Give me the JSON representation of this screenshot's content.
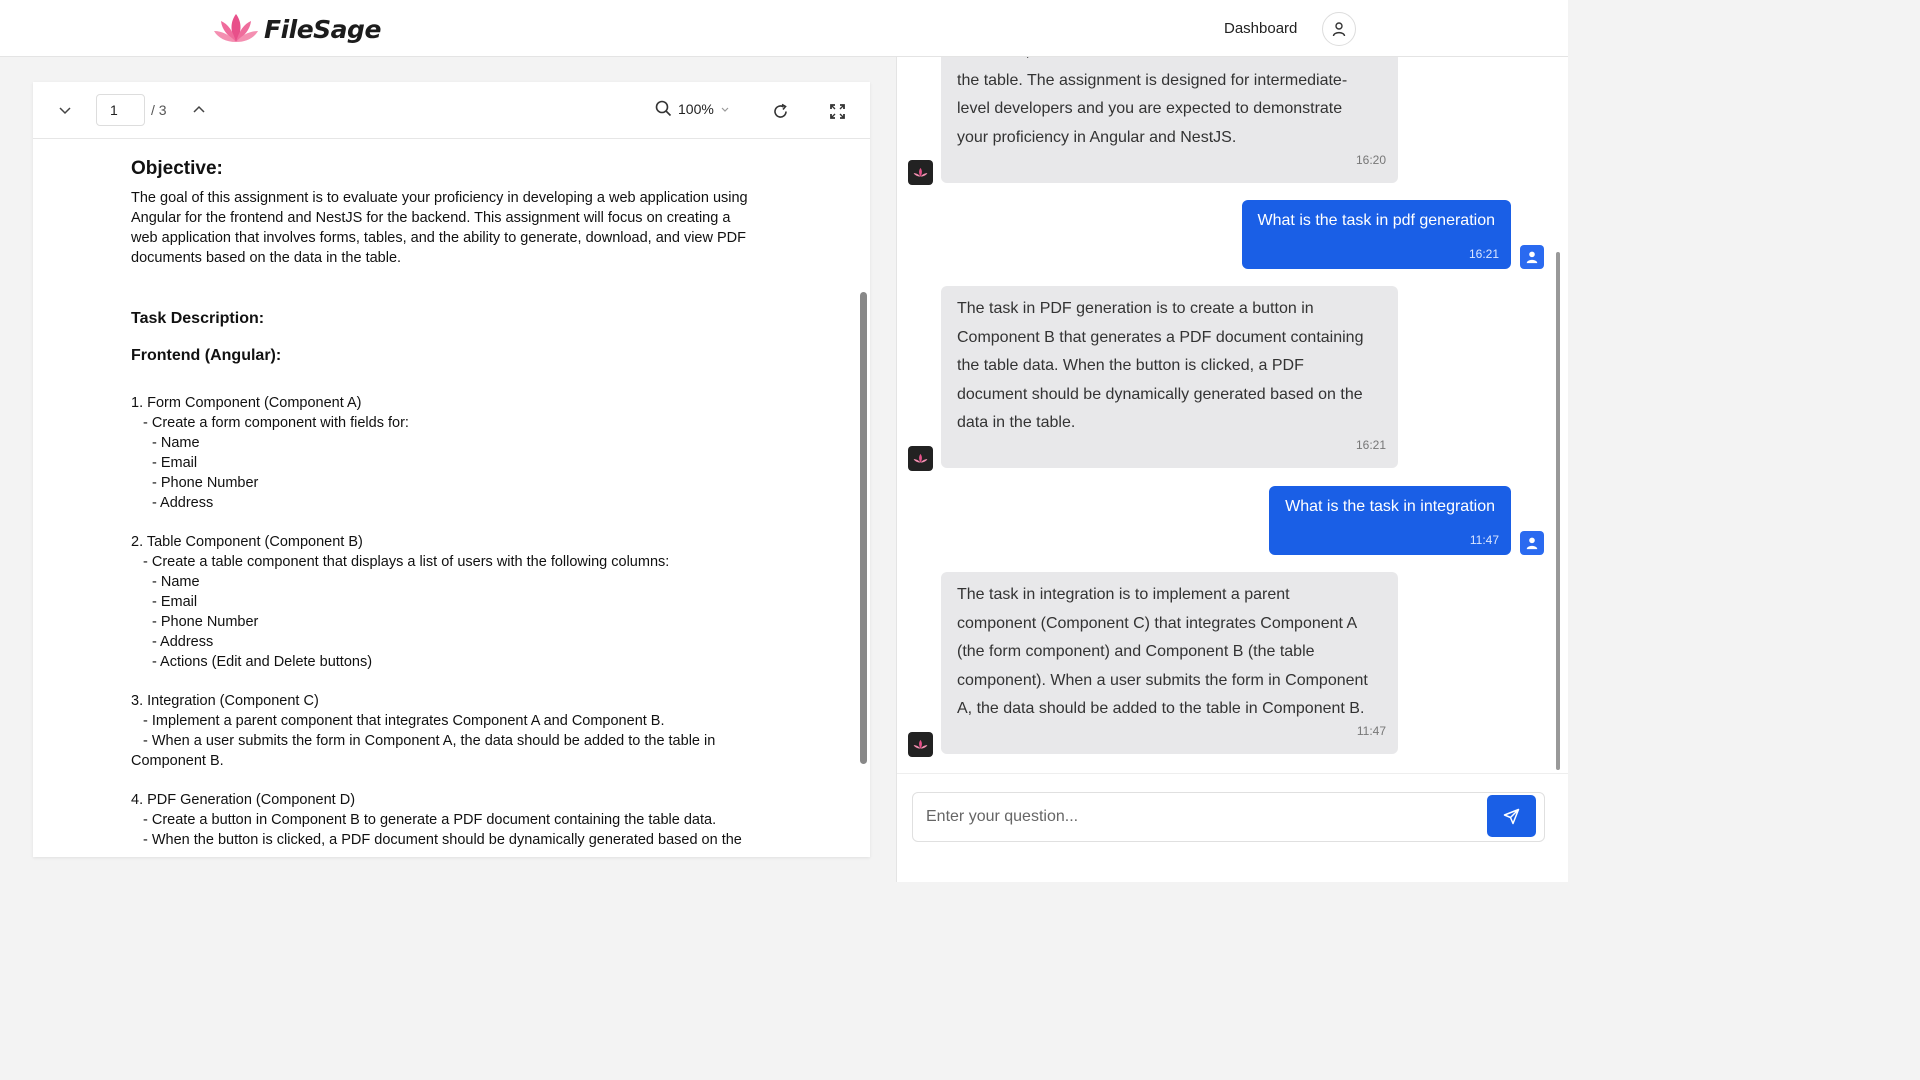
{
  "app": {
    "name": "FileSage"
  },
  "header": {
    "dashboard_label": "Dashboard"
  },
  "viewer": {
    "current_page": "1",
    "total_pages": "/ 3",
    "zoom": "100%"
  },
  "document": {
    "objective_heading": "Objective:",
    "objective_lines": [
      "The goal of this assignment is to evaluate your proficiency in developing a web application using",
      "Angular for the frontend and NestJS for the backend. This assignment will focus on creating a",
      "web application that involves forms, tables, and the ability to generate, download, and view PDF",
      "documents based on the data in the table."
    ],
    "task_heading": "Task Description:",
    "frontend_heading": "Frontend (Angular):",
    "sec1": [
      "1. Form Component (Component A)",
      "   - Create a form component with fields for:",
      "     - Name",
      "     - Email",
      "     - Phone Number",
      "     - Address"
    ],
    "sec2": [
      "2. Table Component (Component B)",
      "   - Create a table component that displays a list of users with the following columns:",
      "     - Name",
      "     - Email",
      "     - Phone Number",
      "     - Address",
      "     - Actions (Edit and Delete buttons)"
    ],
    "sec3": [
      "3. Integration (Component C)",
      "   - Implement a parent component that integrates Component A and Component B.",
      "   - When a user submits the form in Component A, the data should be added to the table in",
      "Component B."
    ],
    "sec4": [
      "4. PDF Generation (Component D)",
      "   - Create a button in Component B to generate a PDF document containing the table data.",
      "   - When the button is clicked, a PDF document should be dynamically generated based on the"
    ]
  },
  "chat": {
    "messages": [
      {
        "role": "bot",
        "lines": [
          "download, and view PDF documents based on the data in",
          "the table. The assignment is designed for intermediate-",
          "level developers and you are expected to demonstrate",
          "your proficiency in Angular and NestJS."
        ],
        "time": "16:20"
      },
      {
        "role": "user",
        "text": "What is the task in pdf generation",
        "time": "16:21"
      },
      {
        "role": "bot",
        "lines": [
          "The task in PDF generation is to create a button in",
          "Component B that generates a PDF document containing",
          "the table data. When the button is clicked, a PDF",
          "document should be dynamically generated based on the",
          "data in the table."
        ],
        "time": "16:21"
      },
      {
        "role": "user",
        "text": "What is the task in integration",
        "time": "11:47"
      },
      {
        "role": "bot",
        "lines": [
          "The task in integration is to implement a parent",
          "component (Component C) that integrates Component A",
          "(the form component) and Component B (the table",
          "component). When a user submits the form in Component",
          "A, the data should be added to the table in Component B."
        ],
        "time": "11:47"
      }
    ],
    "input_placeholder": "Enter your question..."
  },
  "colors": {
    "accent": "#1a5fe6",
    "bot_bubble": "#e8e8ea",
    "logo_pink": "#e8508a"
  }
}
